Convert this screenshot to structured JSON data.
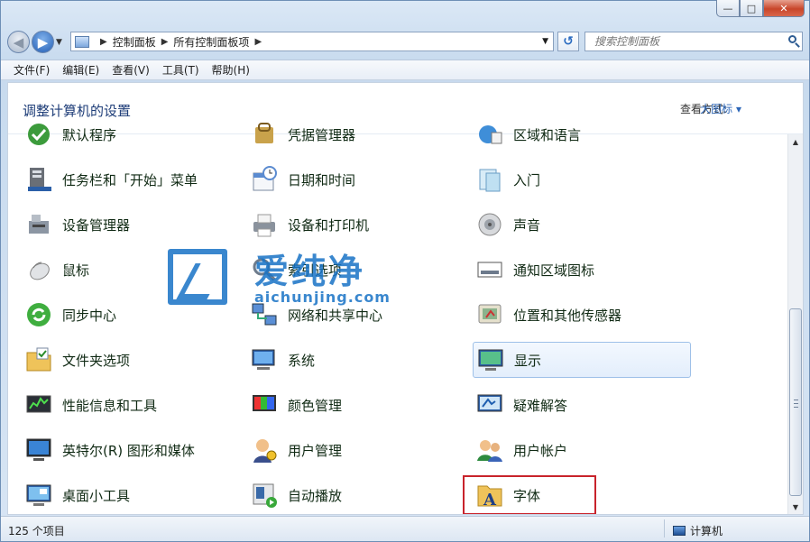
{
  "window": {
    "minimize_glyph": "—",
    "maximize_glyph": "□",
    "close_glyph": "✕"
  },
  "address": {
    "crumbs": [
      "控制面板",
      "所有控制面板项"
    ]
  },
  "search": {
    "placeholder": "搜索控制面板"
  },
  "menu": [
    "文件(F)",
    "编辑(E)",
    "查看(V)",
    "工具(T)",
    "帮助(H)"
  ],
  "header": {
    "title": "调整计算机的设置",
    "view_by_label": "查看方式:",
    "view_mode": "大图标"
  },
  "items": [
    {
      "label": "默认程序",
      "icon": "default-programs-icon"
    },
    {
      "label": "凭据管理器",
      "icon": "credential-manager-icon"
    },
    {
      "label": "区域和语言",
      "icon": "region-language-icon"
    },
    {
      "label": "任务栏和「开始」菜单",
      "icon": "taskbar-icon"
    },
    {
      "label": "日期和时间",
      "icon": "calendar-clock-icon"
    },
    {
      "label": "入门",
      "icon": "getting-started-icon"
    },
    {
      "label": "设备管理器",
      "icon": "device-manager-icon"
    },
    {
      "label": "设备和打印机",
      "icon": "printer-icon"
    },
    {
      "label": "声音",
      "icon": "speaker-icon"
    },
    {
      "label": "鼠标",
      "icon": "mouse-icon"
    },
    {
      "label": "索引选项",
      "icon": "magnifier-icon"
    },
    {
      "label": "通知区域图标",
      "icon": "notification-area-icon"
    },
    {
      "label": "同步中心",
      "icon": "sync-icon"
    },
    {
      "label": "网络和共享中心",
      "icon": "network-icon"
    },
    {
      "label": "位置和其他传感器",
      "icon": "location-sensor-icon"
    },
    {
      "label": "文件夹选项",
      "icon": "folder-options-icon"
    },
    {
      "label": "系统",
      "icon": "system-icon"
    },
    {
      "label": "显示",
      "icon": "display-icon"
    },
    {
      "label": "性能信息和工具",
      "icon": "performance-icon"
    },
    {
      "label": "颜色管理",
      "icon": "color-management-icon"
    },
    {
      "label": "疑难解答",
      "icon": "troubleshooting-icon"
    },
    {
      "label": "英特尔(R) 图形和媒体",
      "icon": "intel-graphics-icon"
    },
    {
      "label": "用户管理",
      "icon": "user-management-icon"
    },
    {
      "label": "用户帐户",
      "icon": "user-accounts-icon"
    },
    {
      "label": "桌面小工具",
      "icon": "gadgets-icon"
    },
    {
      "label": "自动播放",
      "icon": "autoplay-icon"
    },
    {
      "label": "字体",
      "icon": "fonts-icon"
    }
  ],
  "status": {
    "count": "125 个项目",
    "location": "计算机"
  },
  "watermark": {
    "text": "爱纯净",
    "url": "aichunjing.com"
  }
}
